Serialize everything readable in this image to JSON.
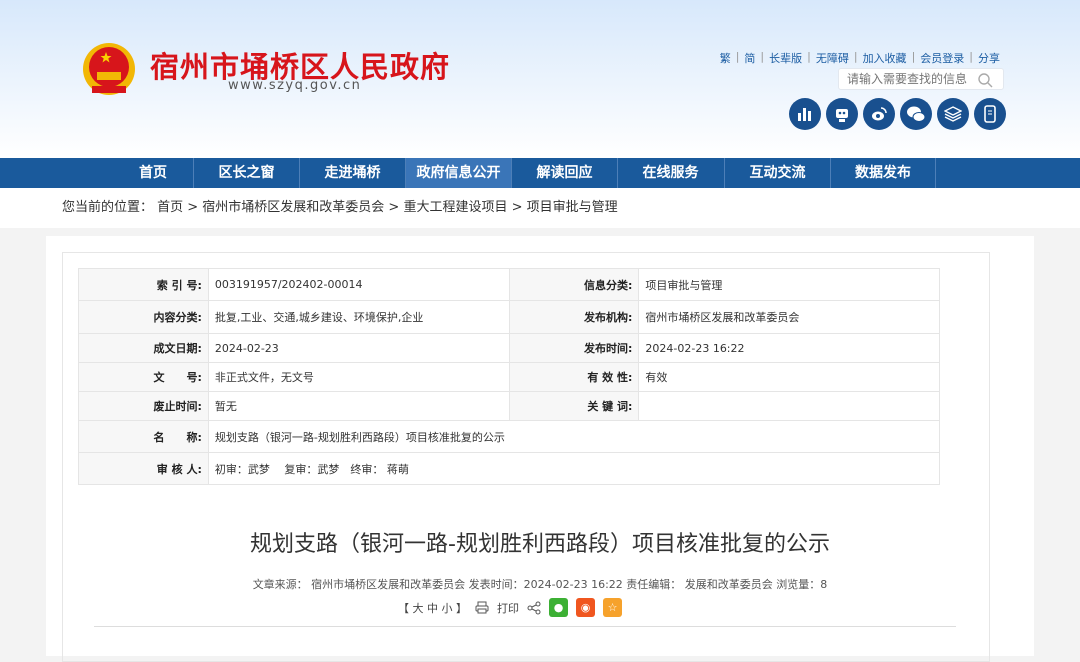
{
  "header": {
    "site_title": "宿州市埇桥区人民政府",
    "site_url": "www.szyq.gov.cn",
    "top_links": [
      "繁",
      "简",
      "长辈版",
      "无障碍",
      "加入收藏",
      "会员登录",
      "分享"
    ],
    "search_placeholder": "请输入需要查找的信息",
    "icons": [
      "data-chart-icon",
      "robot-icon",
      "weibo-icon",
      "wechat-icon",
      "layers-icon",
      "mobile-icon"
    ]
  },
  "nav": [
    "首页",
    "区长之窗",
    "走进埇桥",
    "政府信息公开",
    "解读回应",
    "在线服务",
    "互动交流",
    "数据发布"
  ],
  "breadcrumb": "您当前的位置： 首页 > 宿州市埇桥区发展和改革委员会 > 重大工程建设项目 > 项目审批与管理",
  "info": {
    "index_label": "索 引 号:",
    "index": "003191957/202402-00014",
    "category_label": "信息分类:",
    "category": "项目审批与管理",
    "content_label": "内容分类:",
    "content": "批复,工业、交通,城乡建设、环境保护,企业",
    "publisher_label": "发布机构:",
    "publisher": "宿州市埇桥区发展和改革委员会",
    "date_label": "成文日期:",
    "date": "2024-02-23",
    "pubtime_label": "发布时间:",
    "pubtime": "2024-02-23 16:22",
    "docno_label": "文　　号:",
    "docno": "非正式文件，无文号",
    "validity_label": "有 效 性:",
    "validity": "有效",
    "expire_label": "废止时间:",
    "expire": "暂无",
    "keywords_label": "关 键 词:",
    "keywords": "",
    "name_label": "名　　称:",
    "name": "规划支路（银河一路-规划胜利西路段）项目核准批复的公示",
    "reviewer_label": "审 核 人:",
    "reviewer": "初审：武梦　 复审：武梦　终审： 蒋萌"
  },
  "article": {
    "title": "规划支路（银河一路-规划胜利西路段）项目核准批复的公示",
    "meta": "文章来源： 宿州市埇桥区发展和改革委员会  发表时间：2024-02-23 16:22   责任编辑： 发展和改革委员会  浏览量：8",
    "font_size": "【 大  中  小 】",
    "print": "打印"
  }
}
